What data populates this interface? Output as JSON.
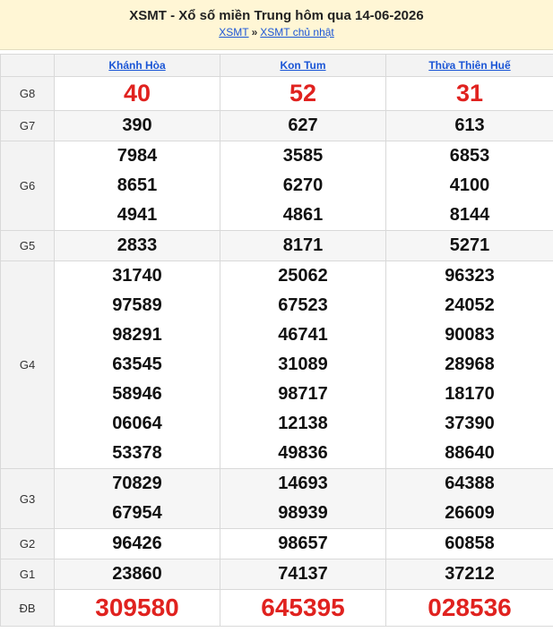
{
  "header": {
    "title": "XSMT - Xổ số miền Trung hôm qua 14-06-2026",
    "crumb_home": "XSMT",
    "crumb_sep": "»",
    "crumb_current": "XSMT chủ nhật"
  },
  "provinces": [
    "Khánh Hòa",
    "Kon Tum",
    "Thừa Thiên Huế"
  ],
  "prizes": [
    {
      "label": "G8",
      "numbers": [
        [
          "40"
        ],
        [
          "52"
        ],
        [
          "31"
        ]
      ]
    },
    {
      "label": "G7",
      "numbers": [
        [
          "390"
        ],
        [
          "627"
        ],
        [
          "613"
        ]
      ]
    },
    {
      "label": "G6",
      "numbers": [
        [
          "7984",
          "8651",
          "4941"
        ],
        [
          "3585",
          "6270",
          "4861"
        ],
        [
          "6853",
          "4100",
          "8144"
        ]
      ]
    },
    {
      "label": "G5",
      "numbers": [
        [
          "2833"
        ],
        [
          "8171"
        ],
        [
          "5271"
        ]
      ]
    },
    {
      "label": "G4",
      "numbers": [
        [
          "31740",
          "97589",
          "98291",
          "63545",
          "58946",
          "06064",
          "53378"
        ],
        [
          "25062",
          "67523",
          "46741",
          "31089",
          "98717",
          "12138",
          "49836"
        ],
        [
          "96323",
          "24052",
          "90083",
          "28968",
          "18170",
          "37390",
          "88640"
        ]
      ]
    },
    {
      "label": "G3",
      "numbers": [
        [
          "70829",
          "67954"
        ],
        [
          "14693",
          "98939"
        ],
        [
          "64388",
          "26609"
        ]
      ]
    },
    {
      "label": "G2",
      "numbers": [
        [
          "96426"
        ],
        [
          "98657"
        ],
        [
          "60858"
        ]
      ]
    },
    {
      "label": "G1",
      "numbers": [
        [
          "23860"
        ],
        [
          "74137"
        ],
        [
          "37212"
        ]
      ]
    },
    {
      "label": "ĐB",
      "numbers": [
        [
          "309580"
        ],
        [
          "645395"
        ],
        [
          "028536"
        ]
      ]
    }
  ],
  "colors": {
    "accent_red": "#e0221f",
    "link_blue": "#1a55d6",
    "header_bg": "#fff6d5"
  }
}
